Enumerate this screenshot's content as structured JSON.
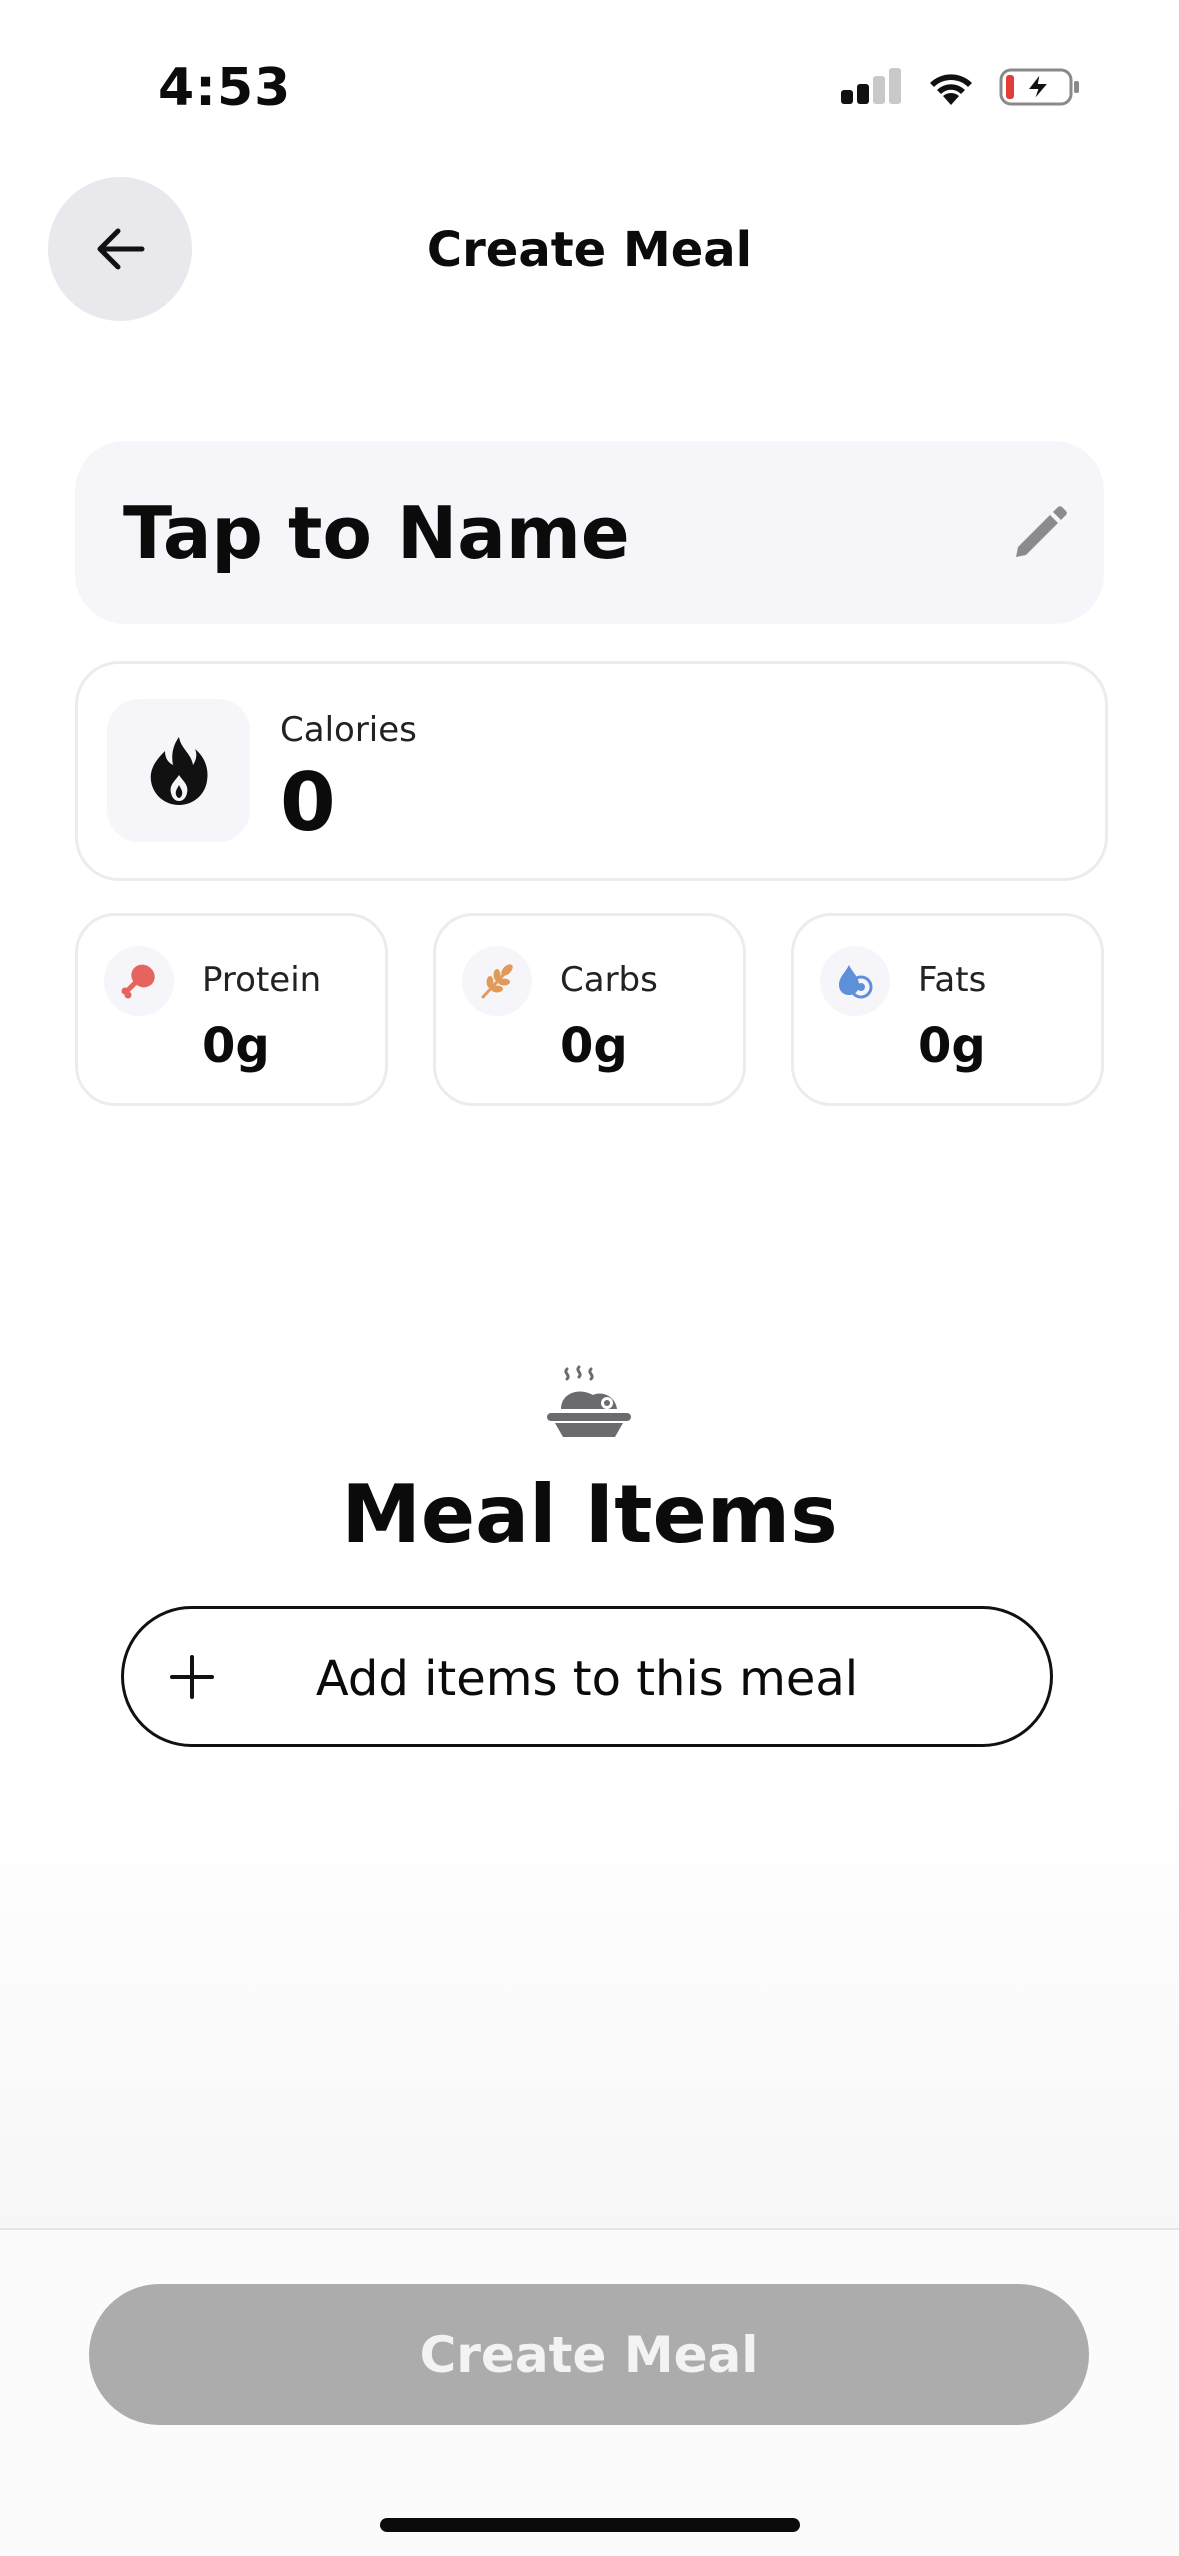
{
  "status_bar": {
    "time": "4:53"
  },
  "header": {
    "title": "Create Meal"
  },
  "name_card": {
    "placeholder_text": "Tap to Name"
  },
  "calories": {
    "label": "Calories",
    "value": "0"
  },
  "macros": [
    {
      "label": "Protein",
      "value": "0g",
      "icon": "drumstick-icon",
      "color": "#e5645f"
    },
    {
      "label": "Carbs",
      "value": "0g",
      "icon": "wheat-icon",
      "color": "#e29a5b"
    },
    {
      "label": "Fats",
      "value": "0g",
      "icon": "water-drop-icon",
      "color": "#5e8fd9"
    }
  ],
  "meal_items": {
    "title": "Meal Items",
    "add_button_label": "Add items to this meal"
  },
  "footer": {
    "create_button_label": "Create Meal"
  }
}
